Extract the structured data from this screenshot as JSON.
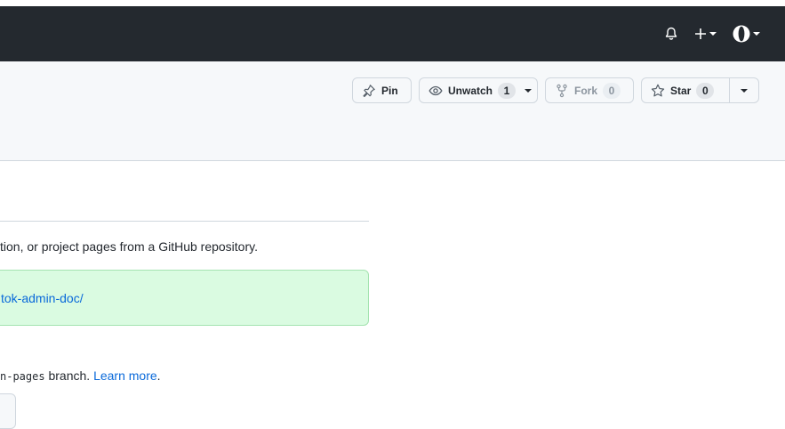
{
  "topbar": {
    "icons": [
      "bell-icon",
      "plus-icon",
      "avatar"
    ]
  },
  "repo_actions": {
    "pin_label": "Pin",
    "unwatch_label": "Unwatch",
    "watch_count": "1",
    "fork_label": "Fork",
    "fork_count": "0",
    "star_label": "Star",
    "star_count": "0"
  },
  "pages": {
    "description": "tion, or project pages from a GitHub repository.",
    "site_url": "tok-admin-doc/",
    "branch_prefix": "n-pages",
    "branch_suffix": " branch. ",
    "learn_more": "Learn more",
    "period": "."
  },
  "colors": {
    "header_bg": "#24292f",
    "success_bg": "#dafbe1",
    "link": "#0969da"
  }
}
